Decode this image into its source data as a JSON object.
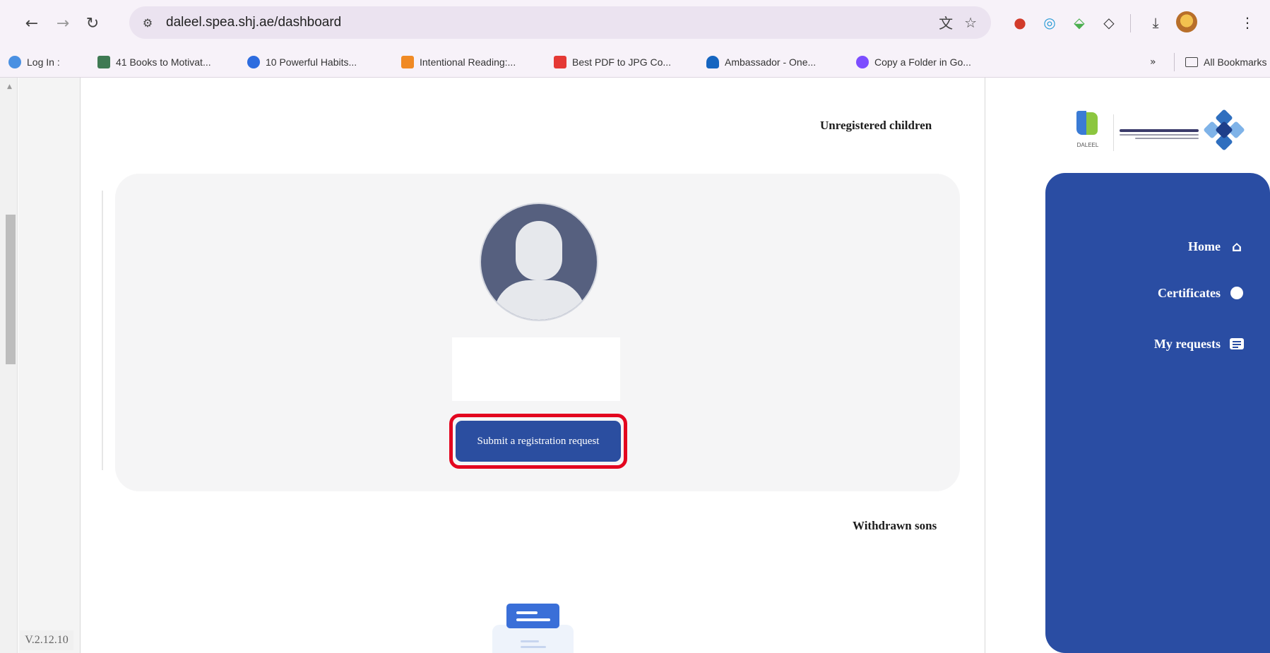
{
  "browser": {
    "url": "daleel.spea.shj.ae/dashboard",
    "nav_icons": {
      "back": "back-arrow-icon",
      "forward": "forward-arrow-icon",
      "reload": "reload-icon"
    },
    "bookmarks": [
      {
        "label": "Log In :",
        "icon": "globe-icon",
        "color": "#4a90e2"
      },
      {
        "label": "41 Books to Motivat...",
        "icon": "book-icon",
        "color": "#3f7a53"
      },
      {
        "label": "10 Powerful Habits...",
        "icon": "circle-icon",
        "color": "#2d6cdf"
      },
      {
        "label": "Intentional Reading:...",
        "icon": "reading-icon",
        "color": "#f08a24"
      },
      {
        "label": "Best PDF to JPG Co...",
        "icon": "pdf-icon",
        "color": "#e53935"
      },
      {
        "label": "Ambassador - One...",
        "icon": "cloud-icon",
        "color": "#1565c0"
      },
      {
        "label": "Copy a Folder in Go...",
        "icon": "g-icon",
        "color": "#7c4dff"
      }
    ],
    "all_bookmarks": "All Bookmarks",
    "overflow": "»"
  },
  "page": {
    "version": "V.2.12.10",
    "unregistered_title": "Unregistered children",
    "submit_label": "Submit a registration request",
    "withdrawn_title": "Withdrawn sons"
  },
  "sidebar": {
    "logo_daleel_text": "DALEEL",
    "items": [
      {
        "label": "Home",
        "icon": "home-icon"
      },
      {
        "label": "Certificates",
        "icon": "badge-icon"
      },
      {
        "label": "My requests",
        "icon": "list-icon"
      }
    ]
  },
  "colors": {
    "sidebar_blue": "#2a4da3",
    "button_blue": "#2b4ea0",
    "highlight_red": "#e3061f"
  }
}
